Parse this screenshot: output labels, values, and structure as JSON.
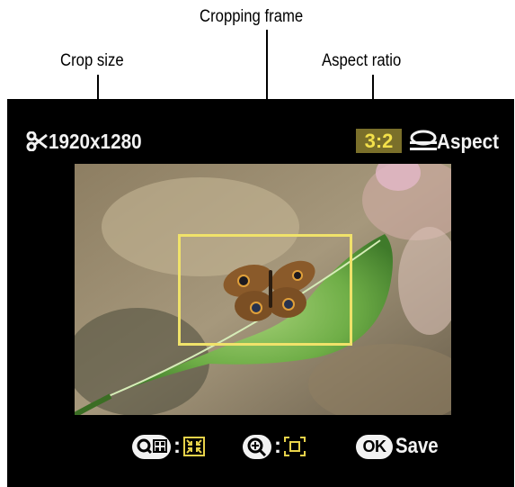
{
  "callouts": {
    "cropping_frame": "Cropping frame",
    "crop_size": "Crop size",
    "aspect_ratio": "Aspect ratio"
  },
  "screen": {
    "crop_size_value": "1920x1280",
    "aspect_ratio_value": "3:2",
    "aspect_label": "Aspect",
    "save_label": "Save",
    "ok_label": "OK",
    "colon": ":"
  },
  "icons": {
    "scissors": "scissors-icon",
    "aspect": "aspect-ratio-icon",
    "zoom_out": "zoom-out-thumbnail-icon",
    "shrink": "shrink-frame-icon",
    "zoom_in": "zoom-in-icon",
    "enlarge": "enlarge-frame-icon"
  },
  "colors": {
    "crop_frame": "#f0e26a",
    "ratio_highlight_bg": "#7a6f2a",
    "ratio_highlight_text": "#f3e04a",
    "screen_bg": "#000000",
    "text": "#f2f2f2"
  }
}
